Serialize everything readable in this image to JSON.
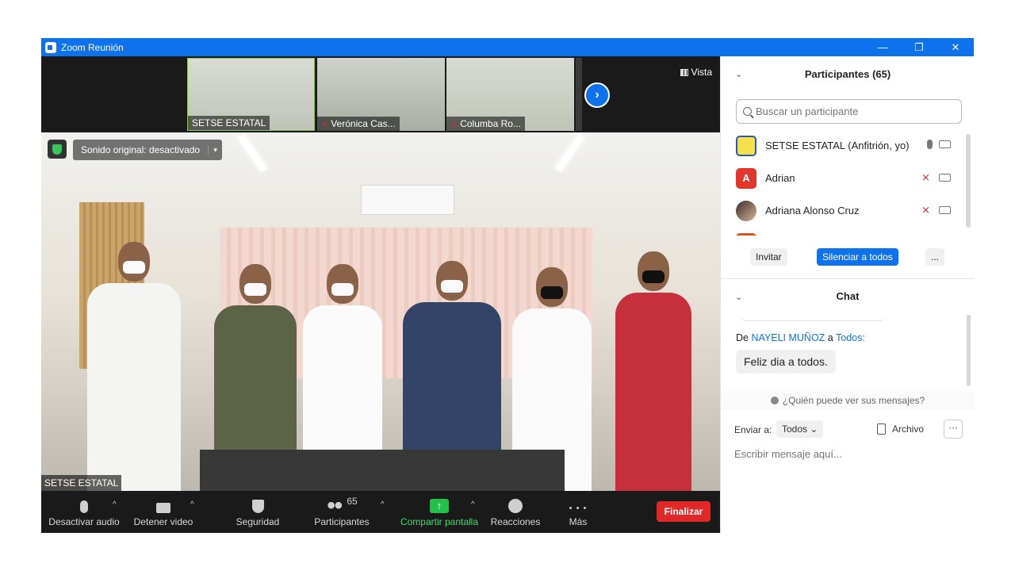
{
  "window": {
    "title": "Zoom Reunión",
    "controls": [
      "—",
      "❐",
      "✕"
    ]
  },
  "strip": {
    "thumbnails": [
      {
        "name": "SETSE ESTATAL",
        "muted": false
      },
      {
        "name": "Verónica Cas...",
        "muted": true
      },
      {
        "name": "Columba Ro...",
        "muted": true
      }
    ],
    "next_label": "›",
    "view_label": "Vista"
  },
  "main_video": {
    "sound_label": "Sonido original: desactivado",
    "caret": "▾",
    "speaker_name": "SETSE ESTATAL"
  },
  "toolbar": {
    "mute_audio": "Desactivar audio",
    "stop_video": "Detener video",
    "security": "Seguridad",
    "participants": "Participantes",
    "participants_count": "65",
    "share": "Compartir pantalla",
    "share_arrow": "↑",
    "reactions": "Reacciones",
    "more": "Más",
    "more_dots": "• • •",
    "caret": "^",
    "end": "Finalizar"
  },
  "participants_panel": {
    "title": "Participantes (65)",
    "collapse": "⌄",
    "search_placeholder": "Buscar un participante",
    "list": [
      {
        "name": "SETSE ESTATAL (Anfitrión, yo)",
        "initial": "",
        "muted": false
      },
      {
        "name": "Adrian",
        "initial": "A",
        "muted": true
      },
      {
        "name": "Adriana Alonso Cruz",
        "initial": "",
        "muted": true
      }
    ],
    "invite": "Invitar",
    "mute_all": "Silenciar a todos",
    "more": "..."
  },
  "chat": {
    "title": "Chat",
    "collapse": "⌄",
    "from_prefix": "De",
    "from_name": "NAYELI MUÑOZ",
    "to_word": "a",
    "to_name": "Todos:",
    "message": "Feliz dia a todos.",
    "who_can_see": "¿Quién puede ver sus mensajes?",
    "send_to_label": "Enviar a:",
    "send_to_value": "Todos ⌄",
    "file": "Archivo",
    "more": "···",
    "input_placeholder": "Escribir mensaje aquí..."
  },
  "colors": {
    "zoom_blue": "#0e72ed",
    "end_red": "#e02828",
    "share_green": "#22c24a"
  }
}
